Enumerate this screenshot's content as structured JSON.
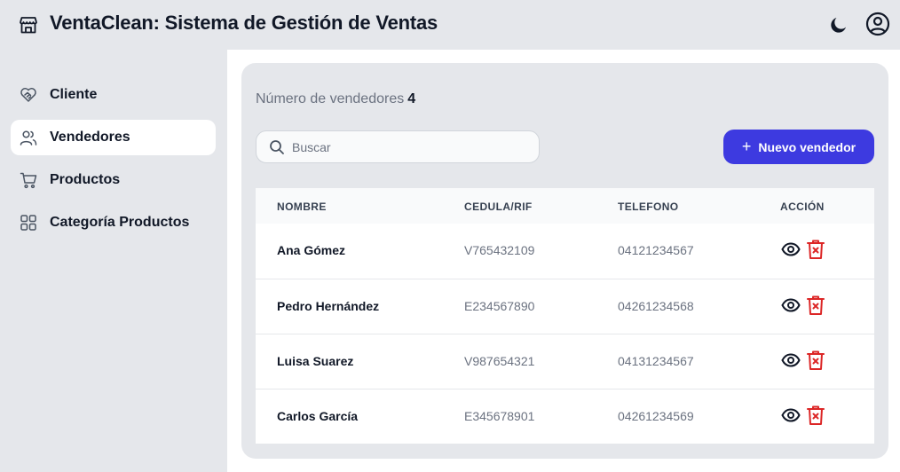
{
  "header": {
    "title": "VentaClean: Sistema de Gestión de Ventas",
    "brand_icon": "store-icon",
    "theme_icon": "moon-icon",
    "user_icon": "user-circle-icon"
  },
  "sidebar": {
    "items": [
      {
        "label": "Cliente",
        "icon": "handshake-heart-icon",
        "active": false
      },
      {
        "label": "Vendedores",
        "icon": "users-icon",
        "active": true
      },
      {
        "label": "Productos",
        "icon": "cart-icon",
        "active": false
      },
      {
        "label": "Categoría Productos",
        "icon": "grid-icon",
        "active": false
      }
    ]
  },
  "main": {
    "count_label": "Número de vendedores",
    "count_value": "4",
    "search_placeholder": "Buscar",
    "search_value": "",
    "new_button_label": "Nuevo vendedor",
    "table": {
      "columns": [
        "NOMBRE",
        "CEDULA/RIF",
        "TELEFONO",
        "ACCIÓN"
      ],
      "rows": [
        {
          "nombre": "Ana Gómez",
          "cedula": "V765432109",
          "telefono": "04121234567"
        },
        {
          "nombre": "Pedro Hernández",
          "cedula": "E234567890",
          "telefono": "04261234568"
        },
        {
          "nombre": "Luisa Suarez",
          "cedula": "V987654321",
          "telefono": "04131234567"
        },
        {
          "nombre": "Carlos García",
          "cedula": "E345678901",
          "telefono": "04261234569"
        }
      ]
    }
  },
  "colors": {
    "accent": "#3d3ae0",
    "danger": "#dc2626",
    "background": "#e5e7eb"
  }
}
